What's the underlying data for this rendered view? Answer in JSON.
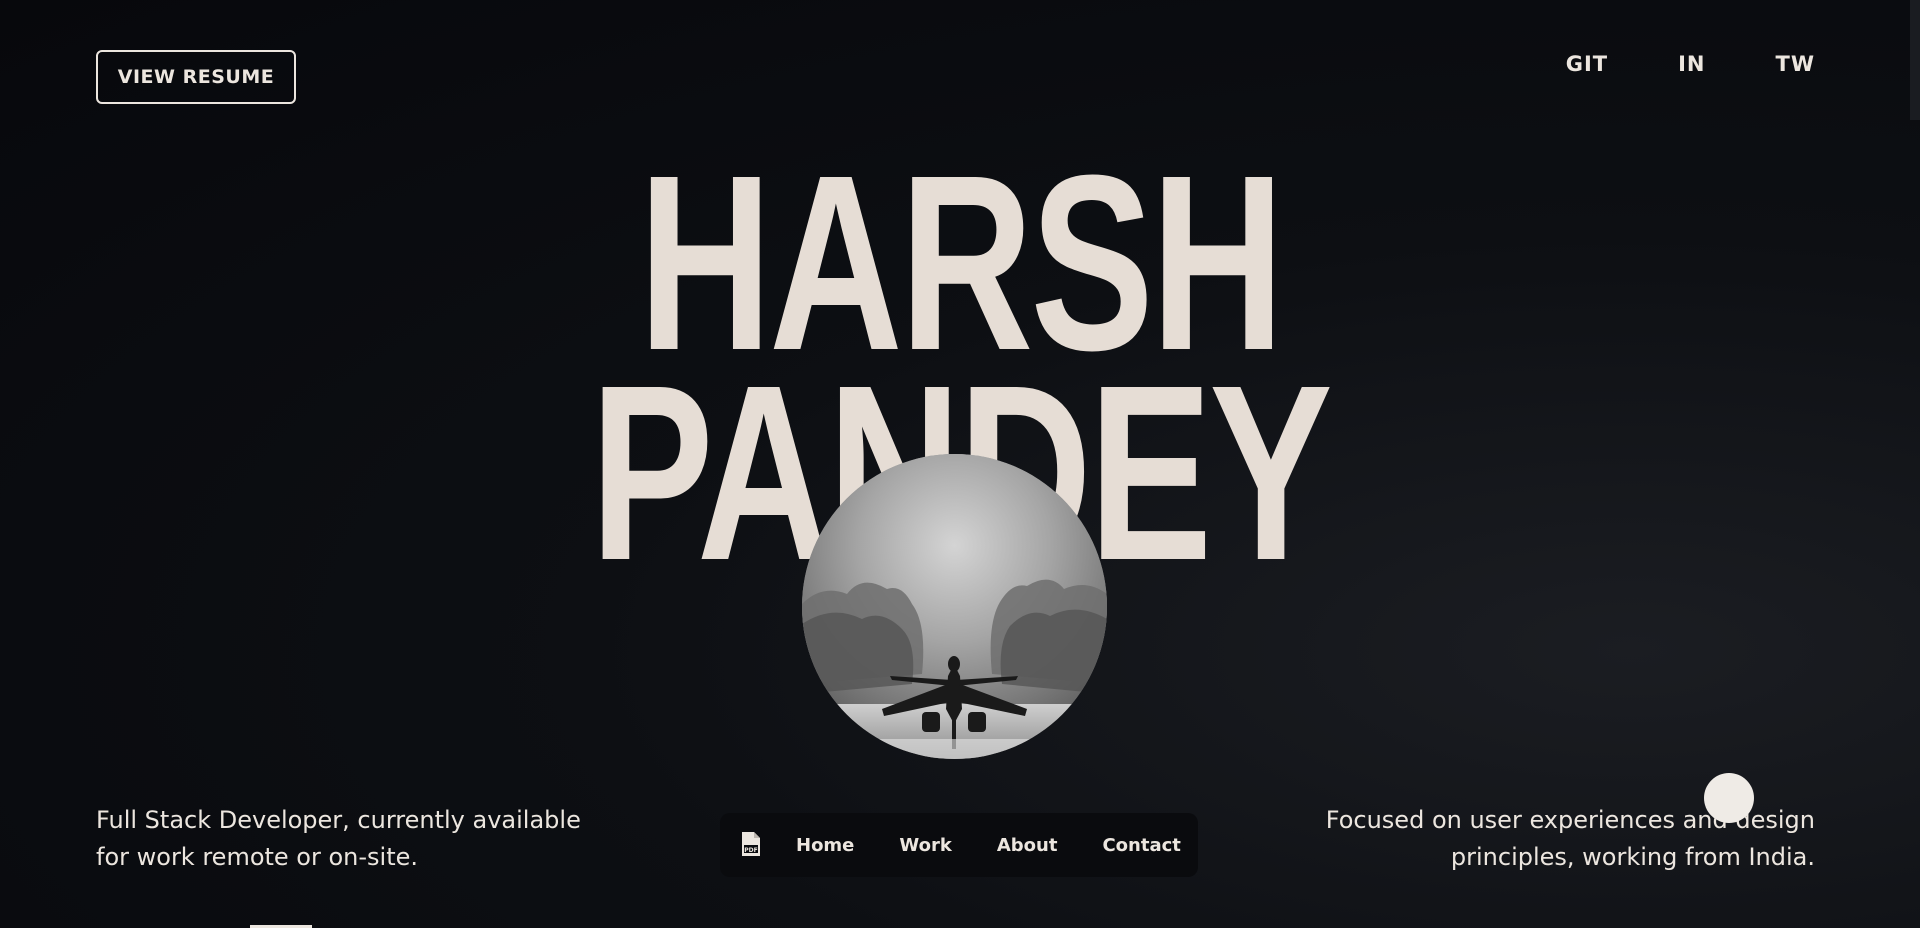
{
  "header": {
    "resume_label": "VIEW RESUME",
    "social": [
      {
        "label": "GIT"
      },
      {
        "label": "IN"
      },
      {
        "label": "TW"
      }
    ]
  },
  "hero": {
    "first_name": "HARSH",
    "last_name": "PANDEY",
    "image_alt": "fighter-jet-monochrome-illustration"
  },
  "footer": {
    "left_tagline_line1": "Full Stack Developer, currently available",
    "left_tagline_line2": "for work remote or on-site.",
    "right_tagline_line1": "Focused on user experiences and design",
    "right_tagline_line2": "principles, working from India."
  },
  "nav": {
    "pdf_icon": "pdf-file-icon",
    "items": [
      {
        "label": "Home"
      },
      {
        "label": "Work"
      },
      {
        "label": "About"
      },
      {
        "label": "Contact"
      }
    ]
  },
  "colors": {
    "background": "#07080c",
    "text": "#ece6df",
    "name": "#e6ddd5",
    "accent_dot": "#efebe6"
  }
}
